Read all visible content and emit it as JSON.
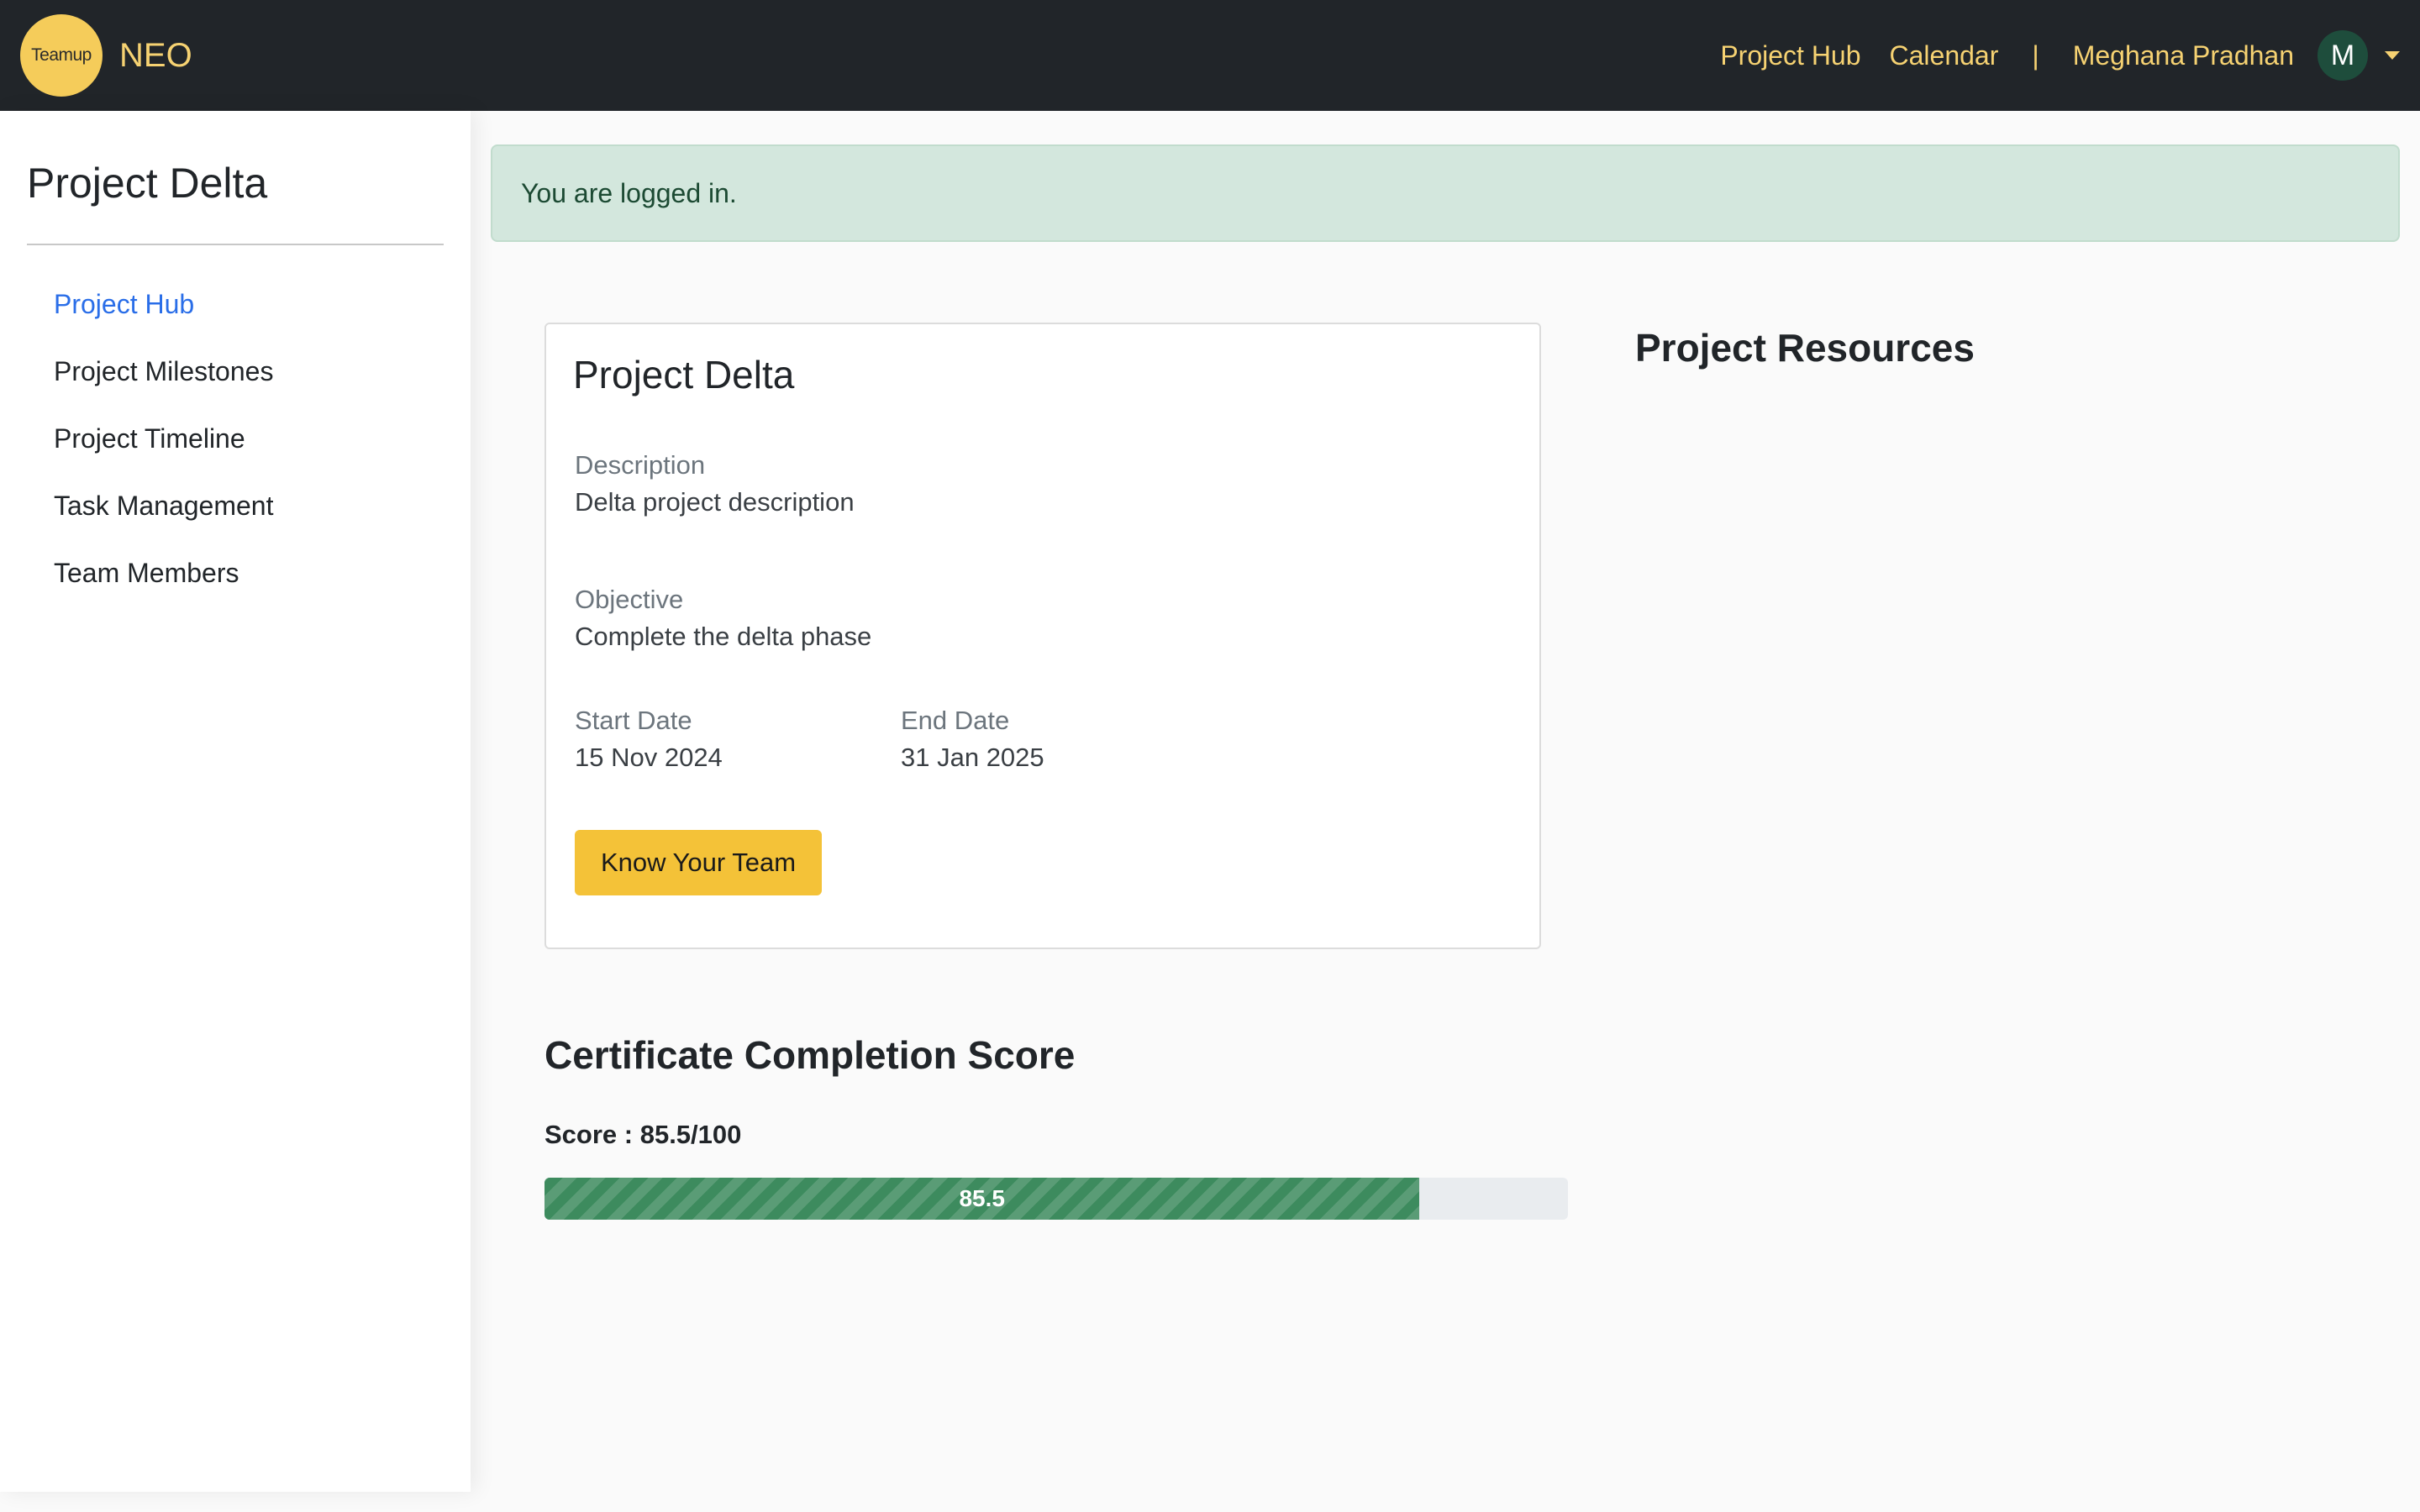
{
  "navbar": {
    "logo_text": "Teamup",
    "brand": "NEO",
    "links": [
      "Project Hub",
      "Calendar"
    ],
    "separator": "|",
    "user_name": "Meghana Pradhan",
    "avatar_initial": "M"
  },
  "sidebar": {
    "title": "Project Delta",
    "items": [
      {
        "label": "Project Hub",
        "active": true
      },
      {
        "label": "Project Milestones",
        "active": false
      },
      {
        "label": "Project Timeline",
        "active": false
      },
      {
        "label": "Task Management",
        "active": false
      },
      {
        "label": "Team Members",
        "active": false
      }
    ]
  },
  "alert": {
    "message": "You are logged in."
  },
  "project": {
    "title": "Project Delta",
    "description_label": "Description",
    "description": "Delta project description",
    "objective_label": "Objective",
    "objective": "Complete the delta phase",
    "start_label": "Start Date",
    "start_date": "15 Nov 2024",
    "end_label": "End Date",
    "end_date": "31 Jan 2025",
    "team_button": "Know Your Team"
  },
  "resources": {
    "title": "Project Resources"
  },
  "certificate": {
    "title": "Certificate Completion Score",
    "score_text": "Score : 85.5/100",
    "score_value": 85.5,
    "score_max": 100,
    "bar_label": "85.5"
  },
  "colors": {
    "navbar_bg": "#212529",
    "accent_yellow": "#f6d272",
    "active_link": "#2a6ee8",
    "progress_green": "#3d8b5e",
    "alert_bg": "#d3e7dd"
  },
  "icons": [
    "caret-down-icon"
  ]
}
